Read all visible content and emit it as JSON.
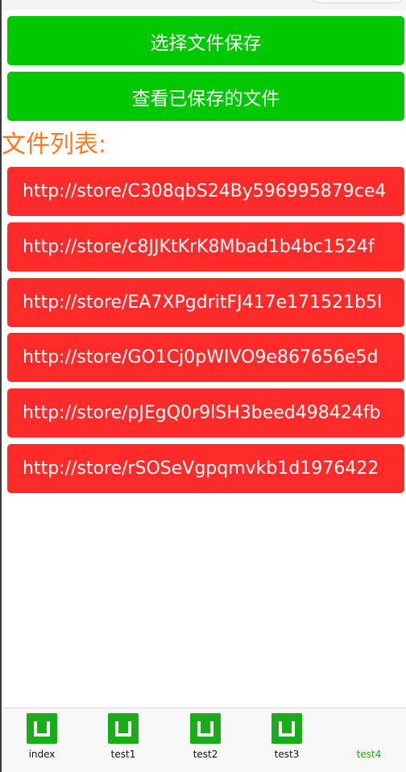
{
  "actions": {
    "select_save_label": "选择文件保存",
    "view_saved_label": "查看已保存的文件"
  },
  "list": {
    "title": "文件列表:",
    "items": [
      "http://store/C308qbS24By596995879ce4",
      "http://store/c8JJKtKrK8Mbad1b4bc1524f",
      "http://store/EA7XPgdritFJ417e171521b5l",
      "http://store/GO1Cj0pWIVO9e867656e5d",
      "http://store/pJEgQ0r9lSH3beed498424fb",
      "http://store/rSOSeVgpqmvkb1d1976422"
    ]
  },
  "tabbar": {
    "tabs": [
      {
        "label": "index",
        "icon": "app-logo-icon"
      },
      {
        "label": "test1",
        "icon": "app-logo-icon"
      },
      {
        "label": "test2",
        "icon": "app-logo-icon"
      },
      {
        "label": "test3",
        "icon": "app-logo-icon"
      },
      {
        "label": "test4",
        "icon": "none"
      }
    ],
    "active_index": 4,
    "active_color": "#1aad19"
  },
  "colors": {
    "button_bg": "#00c800",
    "list_item_bg": "#ff2a2a",
    "title_color": "#ff7a1f"
  }
}
